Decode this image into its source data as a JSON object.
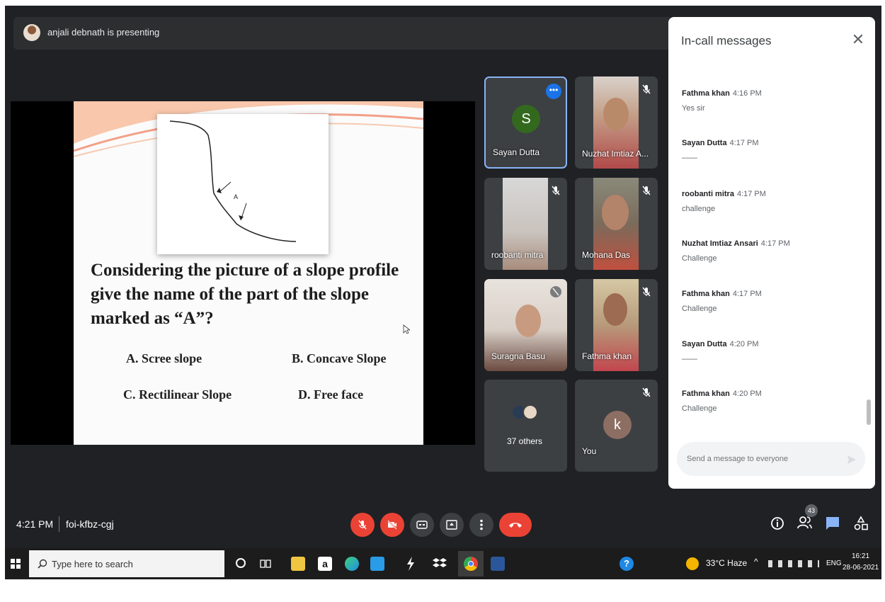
{
  "presenter": {
    "text": "anjali debnath is presenting"
  },
  "slide": {
    "diagram_label": "A",
    "question": "Considering the picture of a slope profile give the name of the part of the slope marked as “A”?",
    "options": [
      "A. Scree slope",
      "B. Concave Slope",
      "C. Rectilinear  Slope",
      "D. Free face"
    ]
  },
  "participants": [
    {
      "name": "Sayan Dutta",
      "type": "letter",
      "letter": "S",
      "color": "#33691e"
    },
    {
      "name": "Nuzhat Imtiaz A...",
      "type": "video",
      "muted": true
    },
    {
      "name": "roobanti mitra",
      "type": "video",
      "muted": true
    },
    {
      "name": "Mohana Das",
      "type": "video",
      "muted": true
    },
    {
      "name": "Suragna Basu",
      "type": "video",
      "muted": true
    },
    {
      "name": "Fathma khan",
      "type": "video",
      "muted": true
    },
    {
      "name": "37 others",
      "type": "others"
    },
    {
      "name": "You",
      "type": "letter",
      "letter": "k",
      "color": "#8d6e63",
      "muted": true
    }
  ],
  "chat": {
    "title": "In-call messages",
    "close_icon": "close-icon",
    "messages": [
      {
        "sender": "Fathma khan",
        "time": "4:16 PM",
        "text": "Yes sir"
      },
      {
        "sender": "Sayan Dutta",
        "time": "4:17 PM",
        "text": "——"
      },
      {
        "sender": "roobanti mitra",
        "time": "4:17 PM",
        "text": "challenge"
      },
      {
        "sender": "Nuzhat Imtiaz Ansari",
        "time": "4:17 PM",
        "text": "Challenge"
      },
      {
        "sender": "Fathma khan",
        "time": "4:17 PM",
        "text": "Challenge"
      },
      {
        "sender": "Sayan Dutta",
        "time": "4:20 PM",
        "text": "——"
      },
      {
        "sender": "Fathma khan",
        "time": "4:20 PM",
        "text": "Challenge"
      }
    ],
    "input_placeholder": "Send a message to everyone"
  },
  "bottom": {
    "time": "4:21 PM",
    "code": "foi-kfbz-cgj",
    "people_count": "43"
  },
  "taskbar": {
    "search_placeholder": "Type here to search",
    "weather": "33°C  Haze",
    "lang": "ENG",
    "clock_time": "16:21",
    "clock_date": "28-06-2021"
  },
  "colors": {
    "accent": "#1a73e8",
    "danger": "#ea4335",
    "meet_bg": "#202124"
  }
}
